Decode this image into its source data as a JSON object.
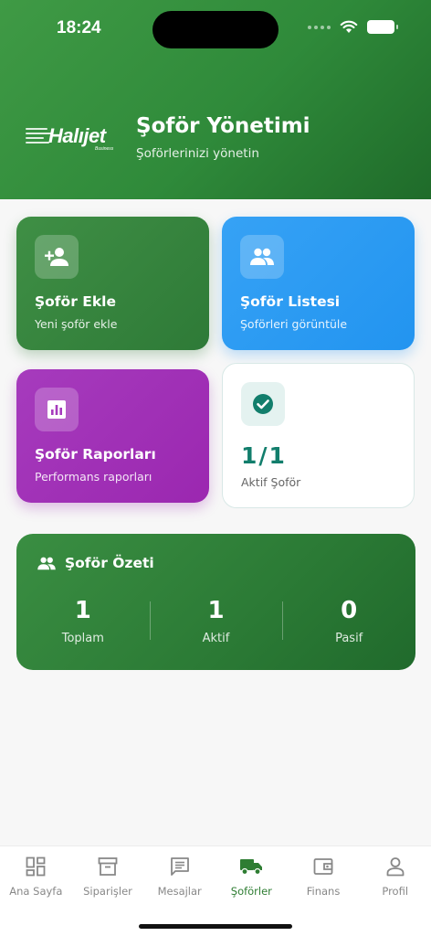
{
  "status_bar": {
    "time": "18:24"
  },
  "header": {
    "brand_name": "Halıjet",
    "brand_sub": "Business",
    "title": "Şoför Yönetimi",
    "subtitle": "Şoförlerinizi yönetin"
  },
  "cards": {
    "add": {
      "title": "Şoför Ekle",
      "subtitle": "Yeni şoför ekle",
      "icon": "person-add-icon"
    },
    "list": {
      "title": "Şoför Listesi",
      "subtitle": "Şoförleri görüntüle",
      "icon": "group-icon"
    },
    "reports": {
      "title": "Şoför Raporları",
      "subtitle": "Performans raporları",
      "icon": "chart-icon"
    },
    "active": {
      "value": "1/1",
      "label": "Aktif Şoför",
      "icon": "check-circle-icon"
    }
  },
  "summary": {
    "title": "Şoför Özeti",
    "stats": [
      {
        "value": "1",
        "label": "Toplam"
      },
      {
        "value": "1",
        "label": "Aktif"
      },
      {
        "value": "0",
        "label": "Pasif"
      }
    ]
  },
  "tabbar": {
    "items": [
      {
        "label": "Ana Sayfa",
        "icon": "dashboard-icon"
      },
      {
        "label": "Siparişler",
        "icon": "archive-icon"
      },
      {
        "label": "Mesajlar",
        "icon": "message-icon"
      },
      {
        "label": "Şoförler",
        "icon": "truck-icon",
        "active": true
      },
      {
        "label": "Finans",
        "icon": "wallet-icon"
      },
      {
        "label": "Profil",
        "icon": "person-icon"
      }
    ]
  },
  "colors": {
    "primary_green": "#2e7d32",
    "blue": "#2294f0",
    "purple": "#9b27b0",
    "teal": "#127e6c"
  }
}
